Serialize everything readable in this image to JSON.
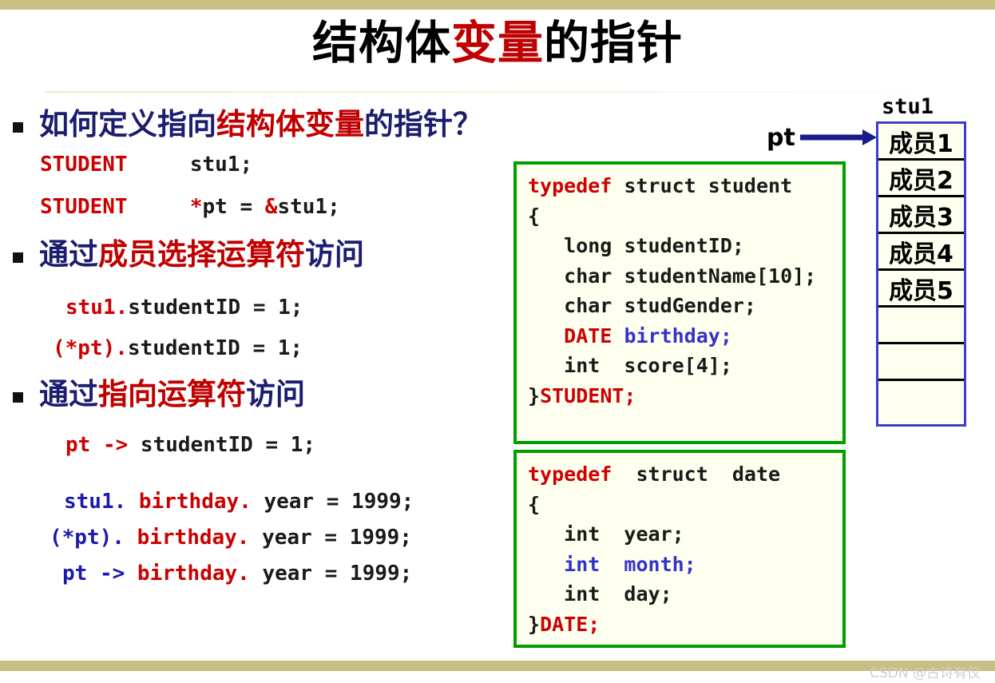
{
  "slide": {
    "title_parts": [
      {
        "text": "结构体",
        "color": "black"
      },
      {
        "text": "变量",
        "color": "red"
      },
      {
        "text": "的指针",
        "color": "black"
      }
    ],
    "title_plain": "结构体变量的指针",
    "accent_red": "#c00000",
    "accent_blue": "#1c1c70",
    "code_red": "#cc0000",
    "code_blue": "#1a1ab0",
    "box_border_green": "#00a000",
    "box_bg": "#fffff0",
    "bar_color": "#c9bf84"
  },
  "bullets": [
    {
      "id": "define-pointer",
      "parts": [
        {
          "text": "如何定义指向",
          "color": "blue"
        },
        {
          "text": "结构体变量",
          "color": "red"
        },
        {
          "text": "的指针？",
          "color": "blue"
        }
      ],
      "plain": "如何定义指向结构体变量的指针？"
    },
    {
      "id": "member-select-operator",
      "parts": [
        {
          "text": "通过",
          "color": "blue"
        },
        {
          "text": "成员选择运算符",
          "color": "red"
        },
        {
          "text": "访问",
          "color": "blue"
        }
      ],
      "plain": "通过成员选择运算符访问"
    },
    {
      "id": "arrow-operator",
      "parts": [
        {
          "text": "通过",
          "color": "blue"
        },
        {
          "text": "指向运算符",
          "color": "red"
        },
        {
          "text": "访问",
          "color": "blue"
        }
      ],
      "plain": "通过指向运算符访问"
    }
  ],
  "code_lines": [
    {
      "id": "decl-stu1",
      "plain": "STUDENT     stu1;",
      "parts": [
        {
          "text": "STUDENT",
          "color": "red"
        },
        {
          "text": "     stu1;",
          "color": "black"
        }
      ]
    },
    {
      "id": "decl-pt",
      "plain": "STUDENT     *pt = &stu1;",
      "parts": [
        {
          "text": "STUDENT",
          "color": "red"
        },
        {
          "text": "     ",
          "color": "black"
        },
        {
          "text": "*",
          "color": "red"
        },
        {
          "text": "pt = ",
          "color": "black"
        },
        {
          "text": "&",
          "color": "red"
        },
        {
          "text": "stu1;",
          "color": "black"
        }
      ]
    },
    {
      "id": "dot-stu1",
      "plain": "stu1.studentID = 1;",
      "parts": [
        {
          "text": "stu1.",
          "color": "red"
        },
        {
          "text": "studentID = 1;",
          "color": "black"
        }
      ]
    },
    {
      "id": "dot-deref-pt",
      "plain": "(*pt).studentID = 1;",
      "parts": [
        {
          "text": "(*pt).",
          "color": "red"
        },
        {
          "text": "studentID = 1;",
          "color": "black"
        }
      ]
    },
    {
      "id": "arrow-pt",
      "plain": "pt -> studentID = 1;",
      "parts": [
        {
          "text": "pt -> ",
          "color": "red"
        },
        {
          "text": "studentID = 1;",
          "color": "black"
        }
      ]
    },
    {
      "id": "nested-stu1",
      "plain": "stu1. birthday. year = 1999;",
      "parts": [
        {
          "text": "stu1. ",
          "color": "blue"
        },
        {
          "text": "birthday. ",
          "color": "red"
        },
        {
          "text": "year = 1999;",
          "color": "black"
        }
      ]
    },
    {
      "id": "nested-deref-pt",
      "plain": "(*pt). birthday. year = 1999;",
      "parts": [
        {
          "text": "(*pt). ",
          "color": "blue"
        },
        {
          "text": "birthday. ",
          "color": "red"
        },
        {
          "text": "year = 1999;",
          "color": "black"
        }
      ]
    },
    {
      "id": "nested-arrow-pt",
      "plain": "pt -> birthday. year = 1999;",
      "parts": [
        {
          "text": "pt -> ",
          "color": "blue"
        },
        {
          "text": "birthday. ",
          "color": "red"
        },
        {
          "text": "year = 1999;",
          "color": "black"
        }
      ]
    }
  ],
  "code_boxes": [
    {
      "id": "struct-student",
      "plain": "typedef struct student\n{\n   long studentID;\n   char studentName[10];\n   char studGender;\n   DATE birthday;\n   int  score[4];\n}STUDENT;",
      "lines": [
        [
          {
            "text": "typedef",
            "color": "red"
          },
          {
            "text": " struct student",
            "color": "black"
          }
        ],
        [
          {
            "text": "{",
            "color": "black"
          }
        ],
        [
          {
            "text": "   long studentID;",
            "color": "black"
          }
        ],
        [
          {
            "text": "   char studentName[10];",
            "color": "black"
          }
        ],
        [
          {
            "text": "   char studGender;",
            "color": "black"
          }
        ],
        [
          {
            "text": "   ",
            "color": "black"
          },
          {
            "text": "DATE",
            "color": "red"
          },
          {
            "text": " ",
            "color": "black"
          },
          {
            "text": "birthday;",
            "color": "blue"
          }
        ],
        [
          {
            "text": "   int  score[4];",
            "color": "black"
          }
        ],
        [
          {
            "text": "}",
            "color": "black"
          },
          {
            "text": "STUDENT;",
            "color": "red"
          }
        ]
      ]
    },
    {
      "id": "struct-date",
      "plain": "typedef  struct  date\n{\n   int  year;\n   int  month;\n   int  day;\n}DATE;",
      "lines": [
        [
          {
            "text": "typedef",
            "color": "red"
          },
          {
            "text": "  struct  date",
            "color": "black"
          }
        ],
        [
          {
            "text": "{",
            "color": "black"
          }
        ],
        [
          {
            "text": "   int  year;",
            "color": "black"
          }
        ],
        [
          {
            "text": "   ",
            "color": "black"
          },
          {
            "text": "int  month;",
            "color": "blue"
          }
        ],
        [
          {
            "text": "   int  day;",
            "color": "black"
          }
        ],
        [
          {
            "text": "}",
            "color": "black"
          },
          {
            "text": "DATE;",
            "color": "red"
          }
        ]
      ]
    }
  ],
  "memory_diagram": {
    "variable_label": "stu1",
    "pointer_label": "pt",
    "arrow_color": "#1a1a8c",
    "border_color": "#3d3dcc",
    "cells": [
      {
        "label": "成员1",
        "empty": false
      },
      {
        "label": "成员2",
        "empty": false
      },
      {
        "label": "成员3",
        "empty": false
      },
      {
        "label": "成员4",
        "empty": false
      },
      {
        "label": "成员5",
        "empty": false
      },
      {
        "label": "",
        "empty": true
      },
      {
        "label": "",
        "empty": true
      },
      {
        "label": "",
        "empty": true
      }
    ]
  },
  "watermark": {
    "text": "CSDN @古诗有仪"
  }
}
